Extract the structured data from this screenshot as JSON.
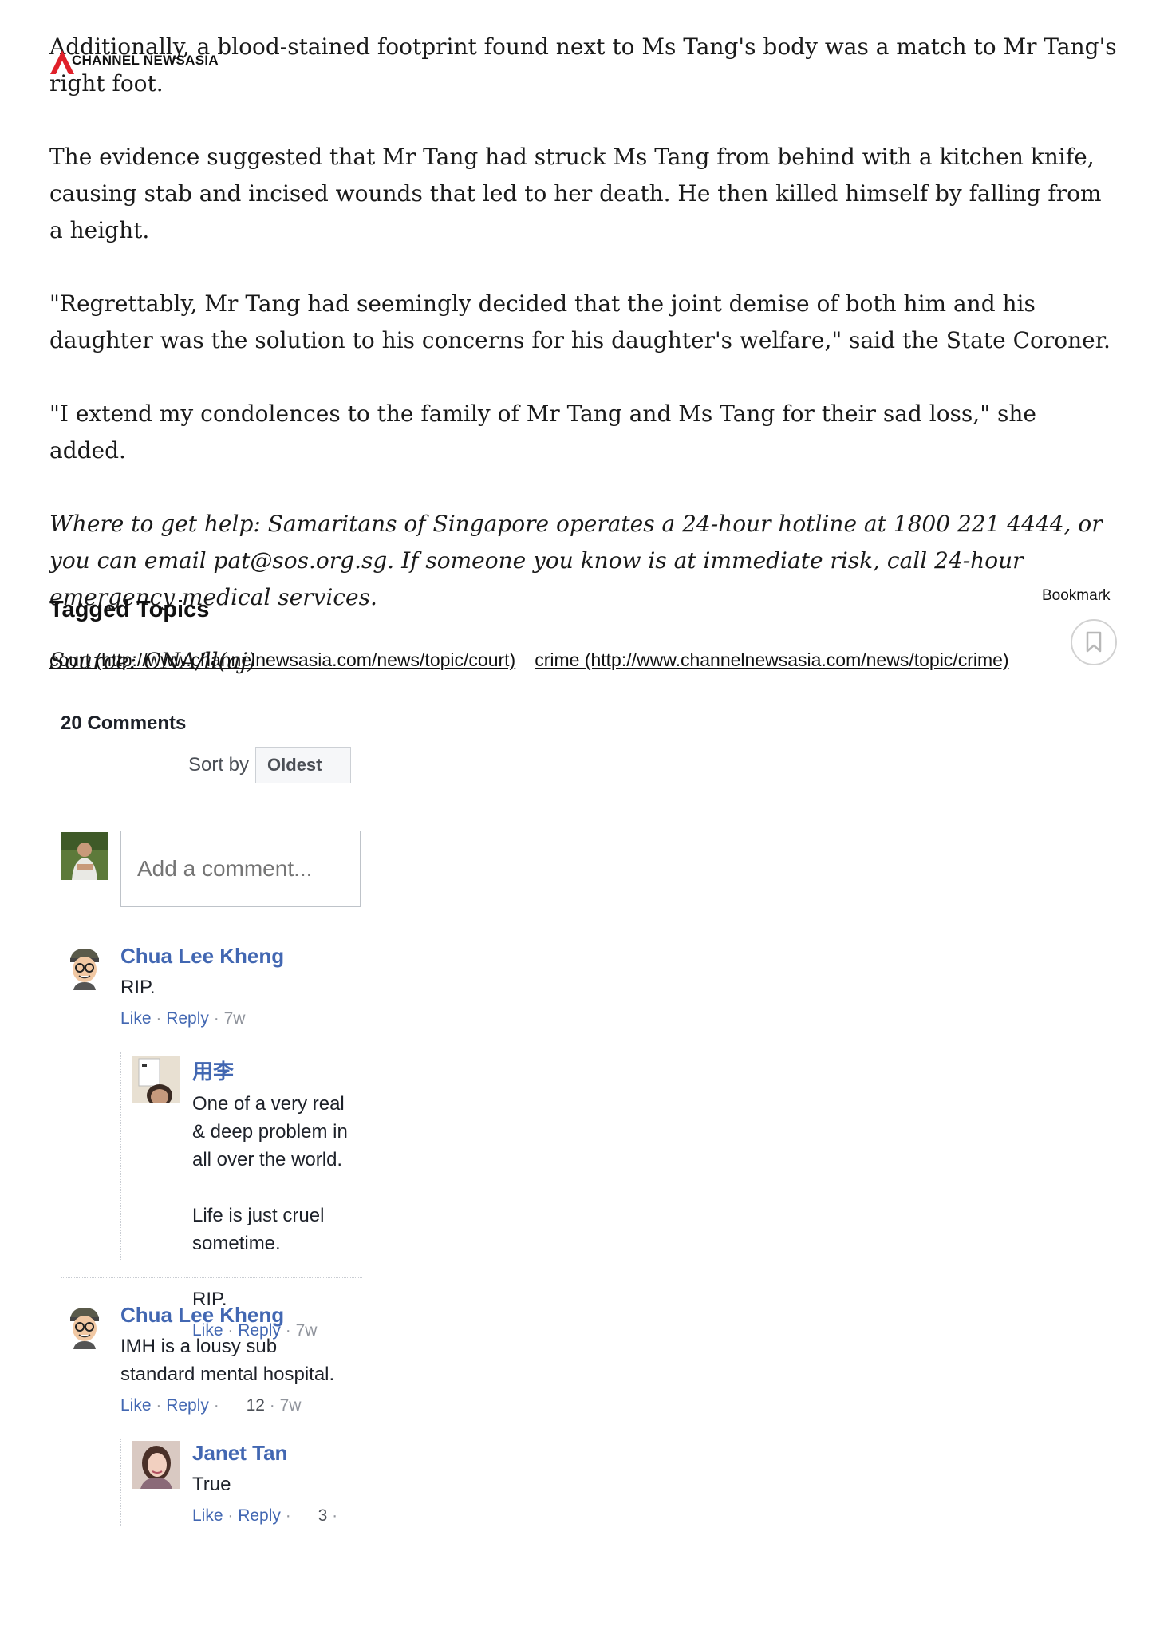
{
  "brand": {
    "logo_text": "CHANNEL NEWSASIA"
  },
  "article": {
    "paragraphs": [
      "Additionally, a blood-stained footprint found next to Ms Tang's body was a match to Mr Tang's right foot.",
      "The evidence suggested that Mr Tang had struck Ms Tang from behind with a kitchen knife, causing stab and incised wounds that led to her death. He then killed himself by falling from a height.",
      "\"Regrettably, Mr Tang had seemingly decided that the joint demise of both him and his daughter was the solution to his concerns for his daughter's welfare,\" said the State Coroner.",
      "\"I extend my condolences to the family of Mr Tang and Ms Tang for their sad loss,\" she added."
    ],
    "help_note": "Where to get help: Samaritans of Singapore operates a 24-hour hotline at 1800 221 4444, or you can email pat@sos.org.sg. If someone you know is at immediate risk, call 24-hour emergency medical services.",
    "source": "Source: CNA/ll(aj)"
  },
  "tagged_topics": {
    "heading": "Tagged Topics",
    "tags": [
      "court (http://www.channelnewsasia.com/news/topic/court)",
      "crime (http://www.channelnewsasia.com/news/topic/crime)"
    ]
  },
  "bookmark": {
    "label": "Bookmark",
    "icon": "bookmark-icon"
  },
  "comments": {
    "count_label": "20 Comments",
    "sort_label": "Sort by",
    "sort_value": "Oldest",
    "input_placeholder": "Add a comment...",
    "items": [
      {
        "name": "Chua Lee Kheng",
        "text": "RIP.",
        "like": "Like",
        "reply": "Reply",
        "time": "7w",
        "replies": [
          {
            "name": "用李",
            "text": "One of a very real\n& deep problem in\nall over the world.\n\nLife is just cruel\nsometime.\n\nRIP.",
            "like": "Like",
            "reply": "Reply",
            "time": "7w"
          }
        ]
      },
      {
        "name": "Chua Lee Kheng",
        "text": "IMH is a lousy sub\nstandard mental hospital.",
        "like": "Like",
        "reply": "Reply",
        "likes": "12",
        "time": "7w",
        "replies": [
          {
            "name": "Janet Tan",
            "text": "True",
            "like": "Like",
            "reply": "Reply",
            "likes": "3"
          }
        ]
      }
    ]
  }
}
